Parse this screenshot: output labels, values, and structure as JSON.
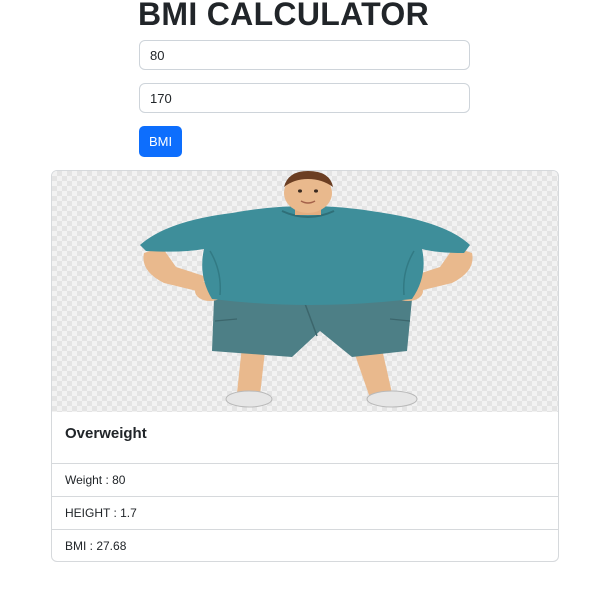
{
  "title": "BMI CALCULATOR",
  "form": {
    "weight_value": "80",
    "height_value": "170",
    "submit_label": "BMI"
  },
  "result": {
    "category": "Overweight",
    "image_icon": "overweight-person-illustration",
    "details": [
      "Weight : 80",
      "HEIGHT : 1.7",
      "BMI : 27.68"
    ]
  },
  "colors": {
    "primary": "#0d6efd",
    "shirt": "#3e8e9a",
    "shorts": "#4d7f86"
  }
}
